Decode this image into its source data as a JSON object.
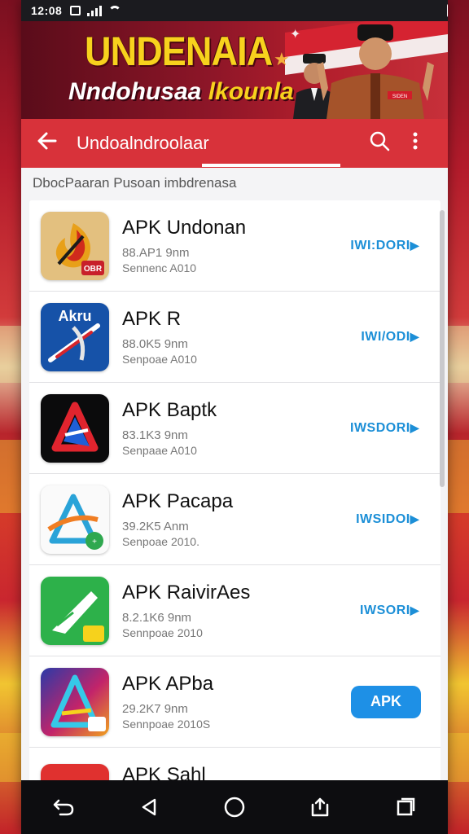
{
  "status_bar": {
    "time": "12:08"
  },
  "banner": {
    "title": "UNDENAIA",
    "subtitle_part1": "Nndohusaa",
    "subtitle_part2": "lkounla",
    "badge": "SIDEN"
  },
  "app_bar": {
    "title": "Undoalndroolaar"
  },
  "section_label": "DbocPaaran Pusoan imbdrenasa",
  "apps": [
    {
      "name": "APK Undonan",
      "size": "88.AP1 9nm",
      "date": "Sennenc A010",
      "action": "IWI:DORI",
      "icon": "flame-app-icon",
      "icon_badge": "OBR"
    },
    {
      "name": "APK R",
      "size": "88.0K5 9nm",
      "date": "Senpoae A010",
      "action": "IWI/ODI",
      "icon": "akru-app-icon",
      "icon_badge": "Akru"
    },
    {
      "name": "APK Baptk",
      "size": "83.1K3 9nm",
      "date": "Senpaae A010",
      "action": "IWSDORI",
      "icon": "a-logo-black-app-icon"
    },
    {
      "name": "APK Pacapa",
      "size": "39.2K5 Anm",
      "date": "Senpoae 2010.",
      "action": "IWSIDOI",
      "icon": "a-logo-white-app-icon"
    },
    {
      "name": "APK RaivirAes",
      "size": "8.2.1K6 9nm",
      "date": "Sennpoae 2010",
      "action": "IWSORI",
      "icon": "green-app-icon"
    },
    {
      "name": "APK APba",
      "size": "29.2K7 9nm",
      "date": "Sennpoae 2010S",
      "action": "APK",
      "icon": "gradient-a-app-icon"
    },
    {
      "name": "APK Sahl",
      "size": "",
      "date": "",
      "action": "",
      "icon": "red-app-icon"
    }
  ],
  "colors": {
    "app_bar": "#d8323a",
    "accent_blue": "#1c8fd7",
    "apk_button": "#1e90e6",
    "banner_title": "#f7d21d"
  }
}
